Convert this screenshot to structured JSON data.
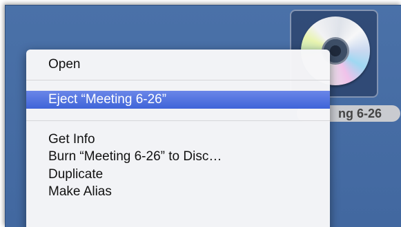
{
  "desktop_icon": {
    "icon": "cd-disc-icon",
    "label": "ng 6-26"
  },
  "context_menu": {
    "items": [
      {
        "label": "Open"
      },
      {
        "label": "Eject “Meeting 6-26”",
        "selected": true
      },
      {
        "label": "Get Info"
      },
      {
        "label": "Burn “Meeting 6-26” to Disc…"
      },
      {
        "label": "Duplicate"
      },
      {
        "label": "Make Alias"
      }
    ]
  },
  "colors": {
    "desktop": "#4a71a8",
    "highlight": "#4a6ee0",
    "menu_bg": "#f6f6f8"
  }
}
